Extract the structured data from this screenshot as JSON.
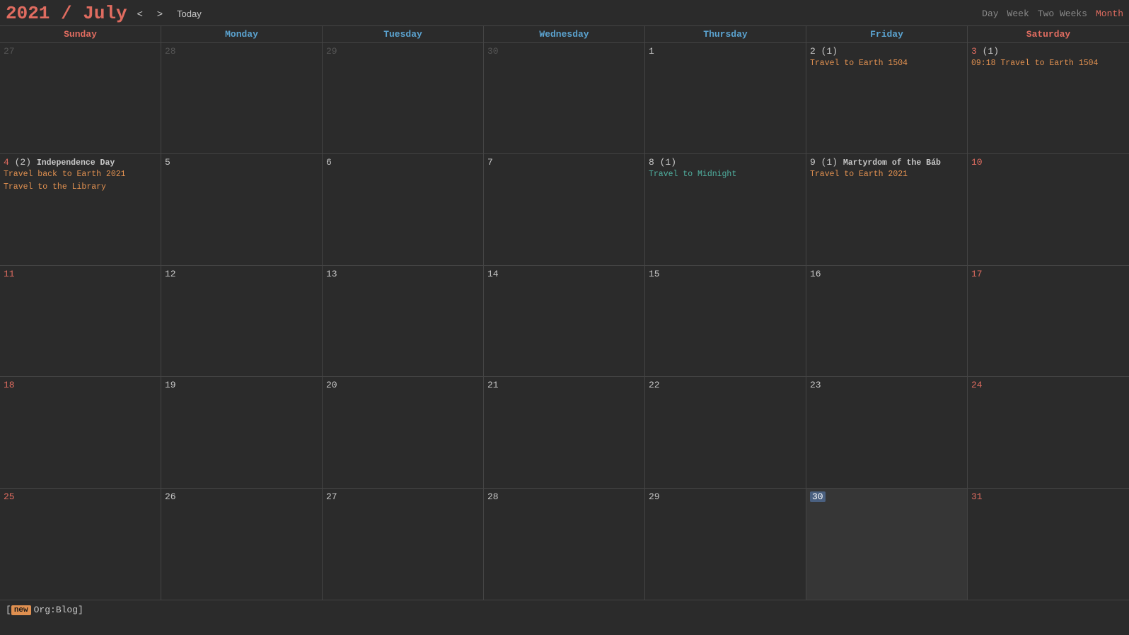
{
  "header": {
    "title_year": "2021",
    "title_sep": " / ",
    "title_month": "July",
    "nav_prev": "<",
    "nav_next": ">",
    "today_label": "Today"
  },
  "view_controls": {
    "day": "Day",
    "week": "Week",
    "two_weeks": "Two Weeks",
    "month": "Month"
  },
  "day_headers": [
    "Sunday",
    "Monday",
    "Tuesday",
    "Wednesday",
    "Thursday",
    "Friday",
    "Saturday"
  ],
  "weeks": [
    {
      "days": [
        {
          "num": "27",
          "other": true,
          "weekend": true
        },
        {
          "num": "28",
          "other": true
        },
        {
          "num": "29",
          "other": true
        },
        {
          "num": "30",
          "other": true
        },
        {
          "num": "1"
        },
        {
          "num": "2",
          "event_count": "(1)",
          "events": [
            {
              "text": "Travel to Earth 1504",
              "class": "event-orange"
            }
          ]
        },
        {
          "num": "3",
          "weekend": true,
          "event_count": "(1)",
          "events": [
            {
              "text": "09:18 Travel to Earth 1504",
              "class": "event-orange"
            }
          ]
        }
      ]
    },
    {
      "days": [
        {
          "num": "4",
          "weekend": true,
          "has_events": true,
          "event_count": "(2)",
          "event_label": "Independence Day",
          "events": [
            {
              "text": "Travel back to Earth 2021",
              "class": "event-orange"
            },
            {
              "text": "Travel to the Library",
              "class": "event-orange"
            }
          ]
        },
        {
          "num": "5"
        },
        {
          "num": "6"
        },
        {
          "num": "7"
        },
        {
          "num": "8",
          "event_count": "(1)",
          "events": [
            {
              "text": "Travel to Midnight",
              "class": "event-teal"
            }
          ]
        },
        {
          "num": "9",
          "event_count": "(1)",
          "event_label": "Martyrdom of the Báb",
          "events": [
            {
              "text": "Travel to Earth 2021",
              "class": "event-orange"
            }
          ]
        },
        {
          "num": "10",
          "weekend": true
        }
      ]
    },
    {
      "days": [
        {
          "num": "11",
          "weekend": true
        },
        {
          "num": "12"
        },
        {
          "num": "13"
        },
        {
          "num": "14"
        },
        {
          "num": "15"
        },
        {
          "num": "16"
        },
        {
          "num": "17",
          "weekend": true
        }
      ]
    },
    {
      "days": [
        {
          "num": "18",
          "weekend": true
        },
        {
          "num": "19"
        },
        {
          "num": "20"
        },
        {
          "num": "21"
        },
        {
          "num": "22"
        },
        {
          "num": "23"
        },
        {
          "num": "24",
          "weekend": true
        }
      ]
    },
    {
      "days": [
        {
          "num": "25",
          "weekend": true
        },
        {
          "num": "26"
        },
        {
          "num": "27"
        },
        {
          "num": "28"
        },
        {
          "num": "29"
        },
        {
          "num": "30",
          "today": true
        },
        {
          "num": "31",
          "weekend": true
        }
      ]
    }
  ],
  "footer": {
    "tag": "new",
    "label": "Org:Blog]"
  }
}
